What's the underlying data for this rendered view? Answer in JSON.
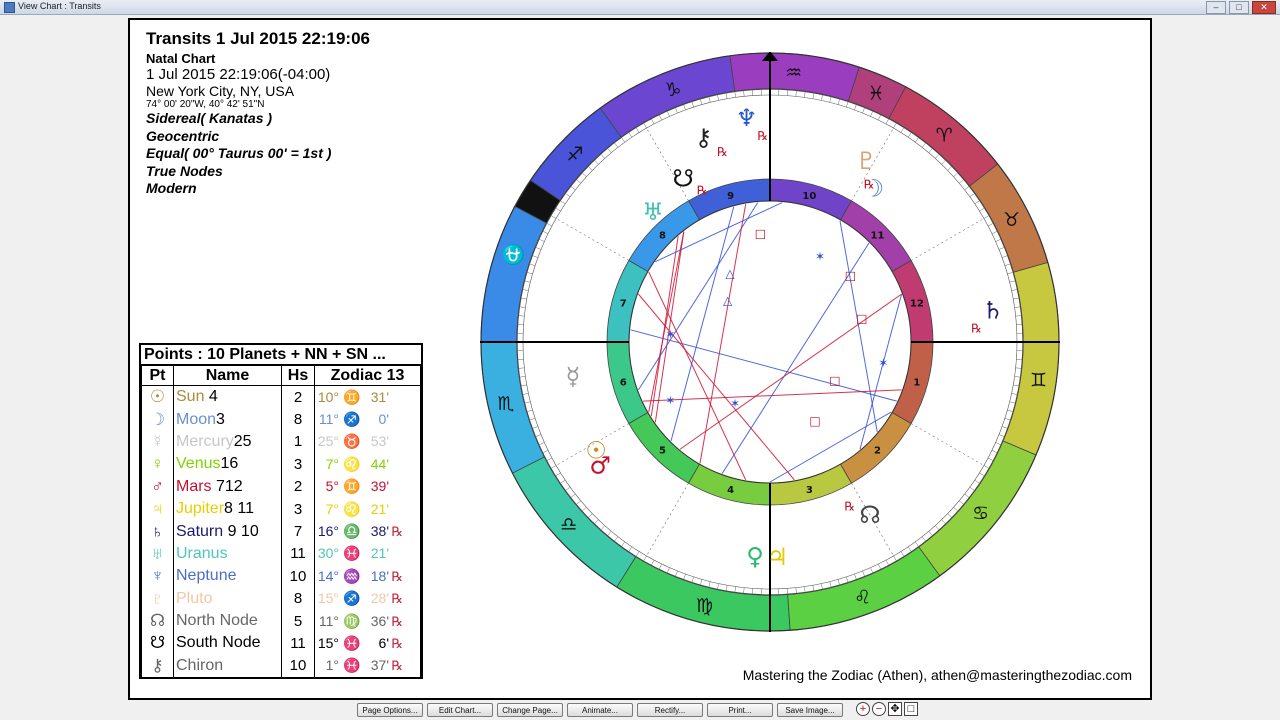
{
  "window": {
    "title": "View Chart : Transits"
  },
  "info": {
    "title": "Transits 1 Jul 2015 22:19:06",
    "chart_type": "Natal Chart",
    "datetime": "1 Jul 2015 22:19:06(-04:00)",
    "place": "New York City, NY, USA",
    "coords": "74° 00' 20\"W, 40° 42' 51\"N",
    "settings": [
      "Sidereal( Kanatas )",
      "Geocentric",
      "Equal( 00° Taurus 00' = 1st )",
      "True Nodes",
      "Modern"
    ]
  },
  "points_table": {
    "heading": "Points : 10 Planets + NN + SN ...",
    "columns": [
      "Pt",
      "Name",
      "Hs",
      "Zodiac 13"
    ],
    "rows": [
      {
        "symbol": "☉",
        "name": "Sun",
        "suffix": " 4",
        "house": "2",
        "deg": "10°",
        "sign": "♊",
        "min": "31'",
        "retro": "",
        "color": "#b08a3c"
      },
      {
        "symbol": "☽",
        "name": "Moon",
        "suffix": "3",
        "house": "8",
        "deg": "11°",
        "sign": "♐",
        "min": "0'",
        "retro": "",
        "color": "#6a8fd0"
      },
      {
        "symbol": "☿",
        "name": "Mercury",
        "suffix": "25",
        "house": "1",
        "deg": "25°",
        "sign": "♉",
        "min": "53'",
        "retro": "",
        "color": "#c7c7c7"
      },
      {
        "symbol": "♀",
        "name": "Venus",
        "suffix": "16",
        "house": "3",
        "deg": "7°",
        "sign": "♌",
        "min": "44'",
        "retro": "",
        "color": "#7fd400"
      },
      {
        "symbol": "♂",
        "name": "Mars",
        "suffix": " 712",
        "house": "2",
        "deg": "5°",
        "sign": "♊",
        "min": "39'",
        "retro": "",
        "color": "#c8102e"
      },
      {
        "symbol": "♃",
        "name": "Jupiter",
        "suffix": "8 11",
        "house": "3",
        "deg": "7°",
        "sign": "♌",
        "min": "21'",
        "retro": "",
        "color": "#e6d000"
      },
      {
        "symbol": "♄",
        "name": "Saturn",
        "suffix": " 9 10",
        "house": "7",
        "deg": "16°",
        "sign": "♎",
        "min": "38'",
        "retro": "℞",
        "color": "#1a1a6e"
      },
      {
        "symbol": "♅",
        "name": "Uranus",
        "suffix": "",
        "house": "11",
        "deg": "30°",
        "sign": "♓",
        "min": "21'",
        "retro": "",
        "color": "#4fc6b8"
      },
      {
        "symbol": "♆",
        "name": "Neptune",
        "suffix": "",
        "house": "10",
        "deg": "14°",
        "sign": "♒",
        "min": "18'",
        "retro": "℞",
        "color": "#4a6fc8"
      },
      {
        "symbol": "♇",
        "name": "Pluto",
        "suffix": "",
        "house": "8",
        "deg": "15°",
        "sign": "♐",
        "min": "28'",
        "retro": "℞",
        "color": "#f0c8a8"
      },
      {
        "symbol": "☊",
        "name": "North Node",
        "suffix": "",
        "house": "5",
        "deg": "11°",
        "sign": "♍",
        "min": "36'",
        "retro": "℞",
        "color": "#666666"
      },
      {
        "symbol": "☋",
        "name": "South Node",
        "suffix": "",
        "house": "11",
        "deg": "15°",
        "sign": "♓",
        "min": "6'",
        "retro": "℞",
        "color": "#000000"
      },
      {
        "symbol": "⚷",
        "name": "Chiron",
        "suffix": "",
        "house": "10",
        "deg": "1°",
        "sign": "♓",
        "min": "37'",
        "retro": "℞",
        "color": "#666666"
      }
    ]
  },
  "wheel": {
    "signs": [
      "♒",
      "♑",
      "♐",
      "⛎",
      "♏",
      "♎",
      "♍",
      "♌",
      "♋",
      "♊",
      "♉",
      "♈",
      "♓"
    ],
    "sign_colors": [
      "#9b3dbf",
      "#6b46d1",
      "#4a54d8",
      "#111111",
      "#3a8ae8",
      "#3ab0e0",
      "#3cc8a8",
      "#3cc860",
      "#5ad042",
      "#90d040",
      "#c8c840",
      "#c07848",
      "#c04060",
      "#b0407c"
    ],
    "houses": [
      "10",
      "9",
      "8",
      "7",
      "6",
      "5",
      "4",
      "3",
      "2",
      "1",
      "12",
      "11"
    ],
    "house_colors": [
      "#7044c8",
      "#4060d8",
      "#3a98e8",
      "#3cc0c0",
      "#3cc888",
      "#44c858",
      "#78cc40",
      "#b8c840",
      "#c89040",
      "#c06048",
      "#c03c70",
      "#a040a8"
    ],
    "planet_glyphs": [
      {
        "glyph": "♆",
        "retro": "℞",
        "color": "#2458c8"
      },
      {
        "glyph": "⚷",
        "retro": "℞",
        "color": "#222222"
      },
      {
        "glyph": "☋",
        "retro": "℞",
        "color": "#111111"
      },
      {
        "glyph": "♅",
        "retro": "",
        "color": "#3cc0b0"
      },
      {
        "glyph": "♇",
        "retro": "℞",
        "color": "#e0a070"
      },
      {
        "glyph": "☽",
        "retro": "",
        "color": "#5080d0"
      },
      {
        "glyph": "♄",
        "retro": "℞",
        "color": "#1a1a6e"
      },
      {
        "glyph": "☊",
        "retro": "℞",
        "color": "#444444"
      },
      {
        "glyph": "♃",
        "retro": "",
        "color": "#e6c800"
      },
      {
        "glyph": "♀",
        "retro": "",
        "color": "#2cb870"
      },
      {
        "glyph": "♂",
        "retro": "",
        "color": "#c8102e"
      },
      {
        "glyph": "☉",
        "retro": "",
        "color": "#c09020"
      },
      {
        "glyph": "☿",
        "retro": "",
        "color": "#999999"
      }
    ]
  },
  "credit": "Mastering the Zodiac (Athen), athen@masteringthezodiac.com",
  "toolbar": {
    "buttons": [
      "Page Options...",
      "Edit Chart...",
      "Change Page...",
      "Animate...",
      "Rectify...",
      "Print...",
      "Save Image..."
    ],
    "zoom": [
      "+",
      "−",
      "✥",
      "□"
    ]
  }
}
